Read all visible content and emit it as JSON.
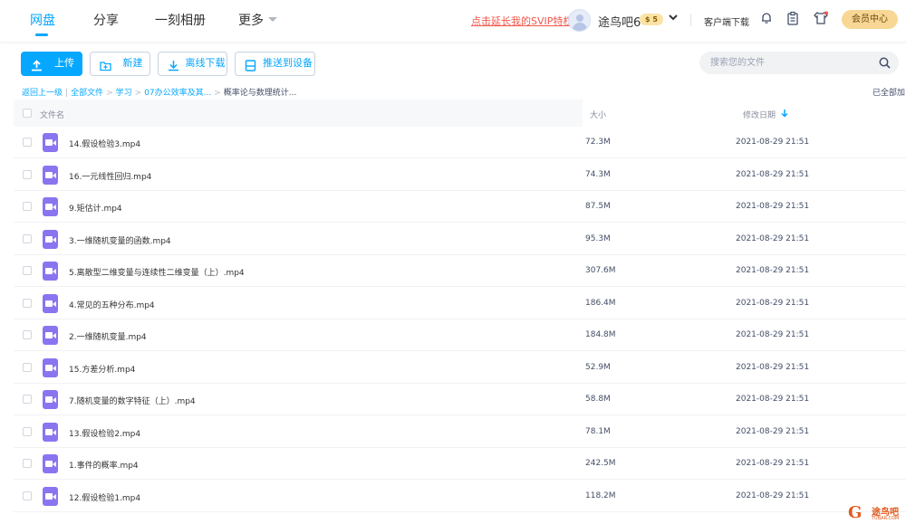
{
  "nav": {
    "tabs": [
      "网盘",
      "分享",
      "一刻相册",
      "更多"
    ],
    "svip_link": "点击延长我的SVIP特权",
    "username": "途鸟吧6",
    "vip_badge": "$ 5",
    "client_download": "客户端下载",
    "member_center": "会员中心"
  },
  "toolbar": {
    "upload": "上传",
    "new": "新建",
    "offline_download": "离线下载",
    "push_to_device": "推送到设备",
    "search_placeholder": "搜索您的文件"
  },
  "breadcrumb": {
    "back": "返回上一级",
    "items": [
      "全部文件",
      "学习",
      "07办公效率及其...",
      "概率论与数理统计..."
    ],
    "loaded_all": "已全部加"
  },
  "table": {
    "col_name": "文件名",
    "col_size": "大小",
    "col_date": "修改日期",
    "rows": [
      {
        "name": "14.假设检验3.mp4",
        "size": "72.3M",
        "date": "2021-08-29 21:51"
      },
      {
        "name": "16.一元线性回归.mp4",
        "size": "74.3M",
        "date": "2021-08-29 21:51"
      },
      {
        "name": "9.矩估计.mp4",
        "size": "87.5M",
        "date": "2021-08-29 21:51"
      },
      {
        "name": "3.一维随机变量的函数.mp4",
        "size": "95.3M",
        "date": "2021-08-29 21:51"
      },
      {
        "name": "5.离散型二维变量与连续性二维变量（上）.mp4",
        "size": "307.6M",
        "date": "2021-08-29 21:51"
      },
      {
        "name": "4.常见的五种分布.mp4",
        "size": "186.4M",
        "date": "2021-08-29 21:51"
      },
      {
        "name": "2.一维随机变量.mp4",
        "size": "184.8M",
        "date": "2021-08-29 21:51"
      },
      {
        "name": "15.方差分析.mp4",
        "size": "52.9M",
        "date": "2021-08-29 21:51"
      },
      {
        "name": "7.随机变量的数字特征（上）.mp4",
        "size": "58.8M",
        "date": "2021-08-29 21:51"
      },
      {
        "name": "13.假设检验2.mp4",
        "size": "78.1M",
        "date": "2021-08-29 21:51"
      },
      {
        "name": "1.事件的概率.mp4",
        "size": "242.5M",
        "date": "2021-08-29 21:51"
      },
      {
        "name": "12.假设检验1.mp4",
        "size": "118.2M",
        "date": "2021-08-29 21:51"
      }
    ]
  },
  "watermark": {
    "title": "途鸟吧",
    "sub": "TUBAR.COM"
  },
  "colors": {
    "accent": "#06a7ff",
    "video_icon": "#8b74f0",
    "svip_link": "#f2564b",
    "member": "#f7d793"
  }
}
